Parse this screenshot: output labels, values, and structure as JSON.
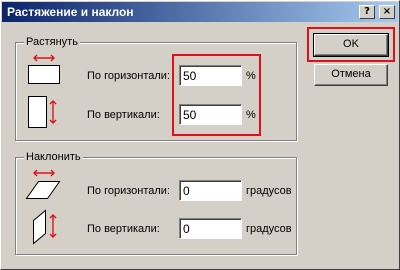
{
  "window": {
    "title": "Растяжение и наклон",
    "help_label": "?",
    "close_label": "×"
  },
  "stretch": {
    "legend": "Растянуть",
    "horizontal_label": "По горизонтали:",
    "horizontal_value": "50",
    "horizontal_unit": "%",
    "vertical_label": "По вертикали:",
    "vertical_value": "50",
    "vertical_unit": "%"
  },
  "skew": {
    "legend": "Наклонить",
    "horizontal_label": "По горизонтали:",
    "horizontal_value": "0",
    "horizontal_unit": "градусов",
    "vertical_label": "По вертикали:",
    "vertical_value": "0",
    "vertical_unit": "градусов"
  },
  "buttons": {
    "ok_label": "OK",
    "cancel_label": "Отмена"
  },
  "icons": {
    "stretch_horizontal": "stretch-horizontal-icon",
    "stretch_vertical": "stretch-vertical-icon",
    "skew_horizontal": "skew-horizontal-icon",
    "skew_vertical": "skew-vertical-icon"
  },
  "colors": {
    "titlebar_start": "#0a246a",
    "titlebar_end": "#a6caf0",
    "dialog_bg": "#d4d0c8",
    "arrow": "#e0101a",
    "highlight": "#e0101a"
  }
}
